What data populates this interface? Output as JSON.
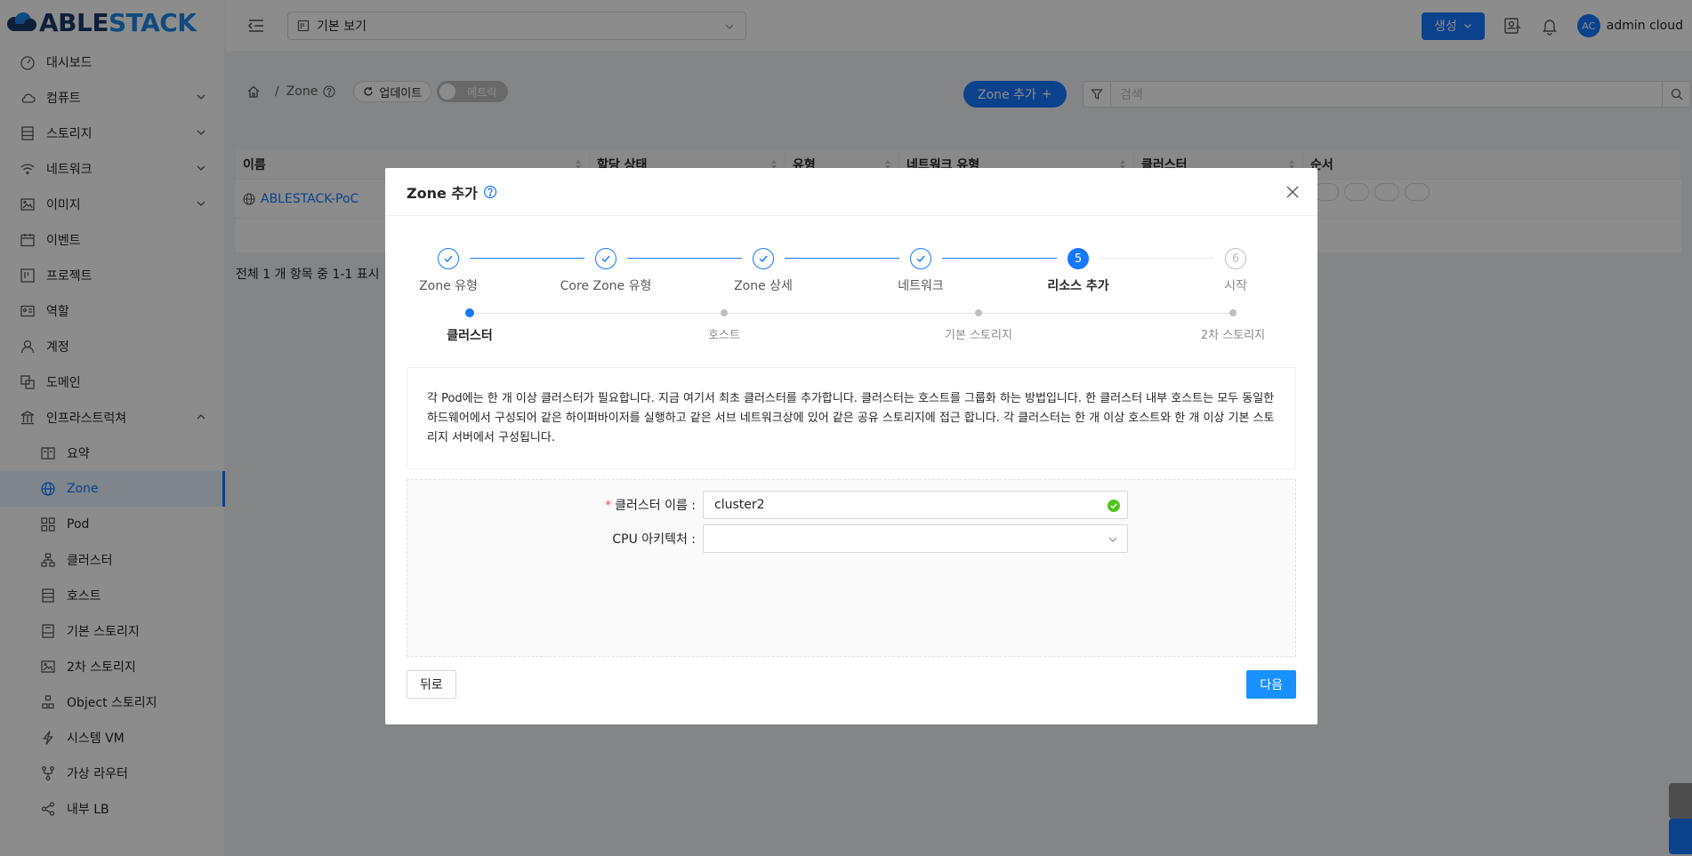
{
  "app": {
    "logo_left": "ABLE",
    "logo_right": "STACK"
  },
  "sidebar": {
    "items": [
      {
        "label": "대시보드",
        "icon": "dashboard-icon"
      },
      {
        "label": "컴퓨트",
        "icon": "cloud-icon",
        "expandable": true
      },
      {
        "label": "스토리지",
        "icon": "storage-icon",
        "expandable": true
      },
      {
        "label": "네트워크",
        "icon": "wifi-icon",
        "expandable": true
      },
      {
        "label": "이미지",
        "icon": "picture-icon",
        "expandable": true
      },
      {
        "label": "이벤트",
        "icon": "schedule-icon"
      },
      {
        "label": "프로젝트",
        "icon": "project-icon"
      },
      {
        "label": "역할",
        "icon": "idcard-icon"
      },
      {
        "label": "계정",
        "icon": "user-icon"
      },
      {
        "label": "도메인",
        "icon": "block-icon"
      },
      {
        "label": "인프라스트럭쳐",
        "icon": "bank-icon",
        "expanded": true
      }
    ],
    "sub_items": [
      {
        "label": "요약",
        "icon": "read-icon"
      },
      {
        "label": "Zone",
        "icon": "global-icon",
        "active": true
      },
      {
        "label": "Pod",
        "icon": "appstore-icon"
      },
      {
        "label": "클러스터",
        "icon": "cluster-icon"
      },
      {
        "label": "호스트",
        "icon": "database-icon"
      },
      {
        "label": "기본 스토리지",
        "icon": "hdd-icon"
      },
      {
        "label": "2차 스토리지",
        "icon": "picture-icon"
      },
      {
        "label": "Object 스토리지",
        "icon": "gold-icon"
      },
      {
        "label": "시스템 VM",
        "icon": "thunderbolt-icon"
      },
      {
        "label": "가상 라우터",
        "icon": "fork-icon"
      },
      {
        "label": "내부 LB",
        "icon": "share-icon"
      }
    ]
  },
  "header": {
    "view_select": "기본 보기",
    "create_label": "생성",
    "user_initials": "AC",
    "user_name": "admin cloud"
  },
  "toolbar": {
    "breadcrumb_current": "Zone",
    "refresh_label": "업데이트",
    "metrics_label": "메트릭",
    "add_zone_label": "Zone 추가",
    "search_placeholder": "검색"
  },
  "table": {
    "columns": [
      "이름",
      "할당 상태",
      "유형",
      "네트워크 유형",
      "클러스터",
      "순서"
    ],
    "rows": [
      {
        "name": "ABLESTACK-PoC"
      }
    ],
    "total_text": "전체 1 개 항목 중 1-1 표시"
  },
  "modal": {
    "title": "Zone 추가",
    "steps": [
      {
        "label": "Zone 유형",
        "status": "done"
      },
      {
        "label": "Core Zone 유형",
        "status": "done"
      },
      {
        "label": "Zone 상세",
        "status": "done"
      },
      {
        "label": "네트워크",
        "status": "done"
      },
      {
        "label": "리소스 추가",
        "status": "current",
        "num": "5"
      },
      {
        "label": "시작",
        "status": "wait",
        "num": "6"
      }
    ],
    "substeps": [
      {
        "label": "클러스터",
        "status": "current"
      },
      {
        "label": "호스트",
        "status": "wait"
      },
      {
        "label": "기본 스토리지",
        "status": "wait"
      },
      {
        "label": "2차 스토리지",
        "status": "wait"
      }
    ],
    "description": "각 Pod에는 한 개 이상 클러스터가 필요합니다. 지금 여기서 최초 클러스터를 추가합니다. 클러스터는 호스트를 그룹화 하는 방법입니다. 한 클러스터 내부 호스트는 모두 동일한 하드웨어에서 구성되어 같은 하이퍼바이저를 실행하고 같은 서브 네트워크상에 있어 같은 공유 스토리지에 접근 합니다. 각 클러스터는 한 개 이상 호스트와 한 개 이상 기본 스토리지 서버에서 구성됩니다.",
    "form": {
      "cluster_name_label": "클러스터 이름",
      "cluster_name_value": "cluster2",
      "cpu_arch_label": "CPU 아키텍처",
      "cpu_arch_value": ""
    },
    "back_label": "뒤로",
    "next_label": "다음"
  },
  "colors": {
    "accent": "#1677ff",
    "success": "#52c41a"
  }
}
